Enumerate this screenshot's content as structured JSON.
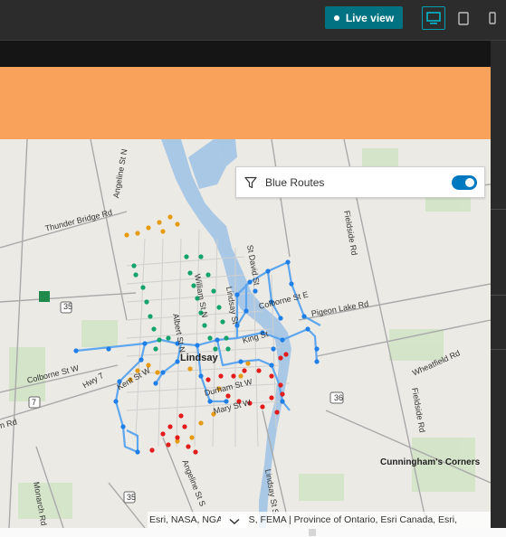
{
  "toolbar": {
    "live_view_label": "Live view",
    "device_icons": [
      "desktop-icon",
      "tablet-icon",
      "phone-icon"
    ]
  },
  "colors": {
    "header_band": "#f8a25b",
    "live_view_bg": "#007281",
    "route_blue": "#2d8fe6",
    "stop_blue": "#1e7fe8",
    "stop_green": "#13a36b",
    "stop_orange": "#e69b12",
    "stop_red": "#e21b1b",
    "toggle_on": "#0079c1"
  },
  "map": {
    "labels": {
      "angeline_n": "Angeline St N",
      "thunder_bridge": "Thunder Bridge Rd",
      "st_davids": "St David St",
      "fieldside_n": "Fieldside Rd",
      "william": "William St N",
      "albert": "Albert St N",
      "lindsay_n": "Lindsay St",
      "colborne_e": "Colborne St E",
      "pigeon_lake": "Pigeon Lake Rd",
      "king": "King St",
      "kent_w": "Kent St W",
      "lindsay_town": "Lindsay",
      "wheatfield": "Wheatfield Rd",
      "colborne_w": "Colborne St W",
      "fieldside_s": "Fieldside Rd",
      "hwy7": "7",
      "hwy36": "36",
      "hwy35_n": "35",
      "hwy35_s": "35",
      "durham": "Durham St W",
      "marys": "Mary St W",
      "glenelg": "n Rd",
      "hwy_left": "Hwy 7",
      "cunningham": "Cunningham's Corners",
      "monarch": "Monarch Rd",
      "angeline_s": "Angeline St S",
      "lindsay_s": "Lindsay St S"
    },
    "attribution": "Esri, NASA, NGA, USGS, FEMA | Province of Ontario, Esri Canada, Esri,"
  },
  "filter": {
    "label": "Blue Routes",
    "toggle_on": true
  }
}
